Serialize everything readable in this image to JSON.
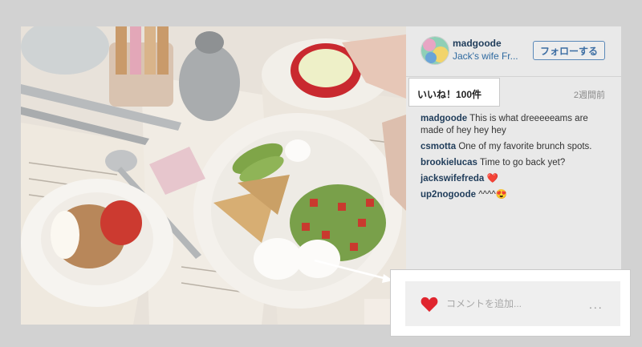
{
  "header": {
    "username": "madgoode",
    "subtitle": "Jack's wife Fr...",
    "follow_label": "フォローする"
  },
  "stats": {
    "likes": "いいね！100件",
    "time": "2週間前"
  },
  "comments": [
    {
      "user": "madgoode",
      "text": "This is what dreeeeeams are made of hey hey hey"
    },
    {
      "user": "csmotta",
      "text": "One of my favorite brunch spots."
    },
    {
      "user": "brookielucas",
      "text": "Time to go back yet?"
    },
    {
      "user": "jackswifefreda",
      "text": "❤️"
    },
    {
      "user": "up2nogoode",
      "text": "^^^^😍"
    }
  ],
  "comment_box": {
    "placeholder": "コメントを追加...",
    "more": "..."
  },
  "colors": {
    "accent": "#1f3c5a",
    "link": "#2f6aa0",
    "heart": "#e0252e"
  }
}
